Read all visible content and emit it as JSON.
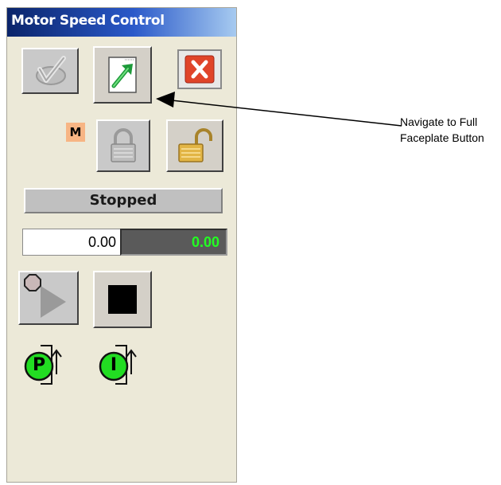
{
  "window": {
    "title": "Motor Speed Control"
  },
  "toolbar": {
    "reset_button": "reset-icon",
    "navigate_button": "navigate-full-faceplate-icon",
    "close_button": "close-icon"
  },
  "mode": {
    "badge": "M",
    "lock_icon": "lock-icon",
    "unlock_icon": "unlock-icon"
  },
  "status": {
    "text": "Stopped"
  },
  "speed": {
    "setpoint": "0.00",
    "actual": "0.00"
  },
  "controls": {
    "start_icon": "play-icon",
    "stop_icon": "stop-icon"
  },
  "indicators": [
    {
      "letter": "P",
      "icon": "program-indicator-icon"
    },
    {
      "letter": "I",
      "icon": "interlock-indicator-icon"
    }
  ],
  "annotation": {
    "line1": "Navigate to Full",
    "line2": "Faceplate Button"
  },
  "colors": {
    "title_bg": "#0a246a",
    "panel_bg": "#ece9d8",
    "status_bg": "#c0c0c0",
    "actual_text": "#22ff22",
    "indicator_green": "#22dd22",
    "close_red": "#e0442a",
    "mode_badge": "#f7b584"
  }
}
